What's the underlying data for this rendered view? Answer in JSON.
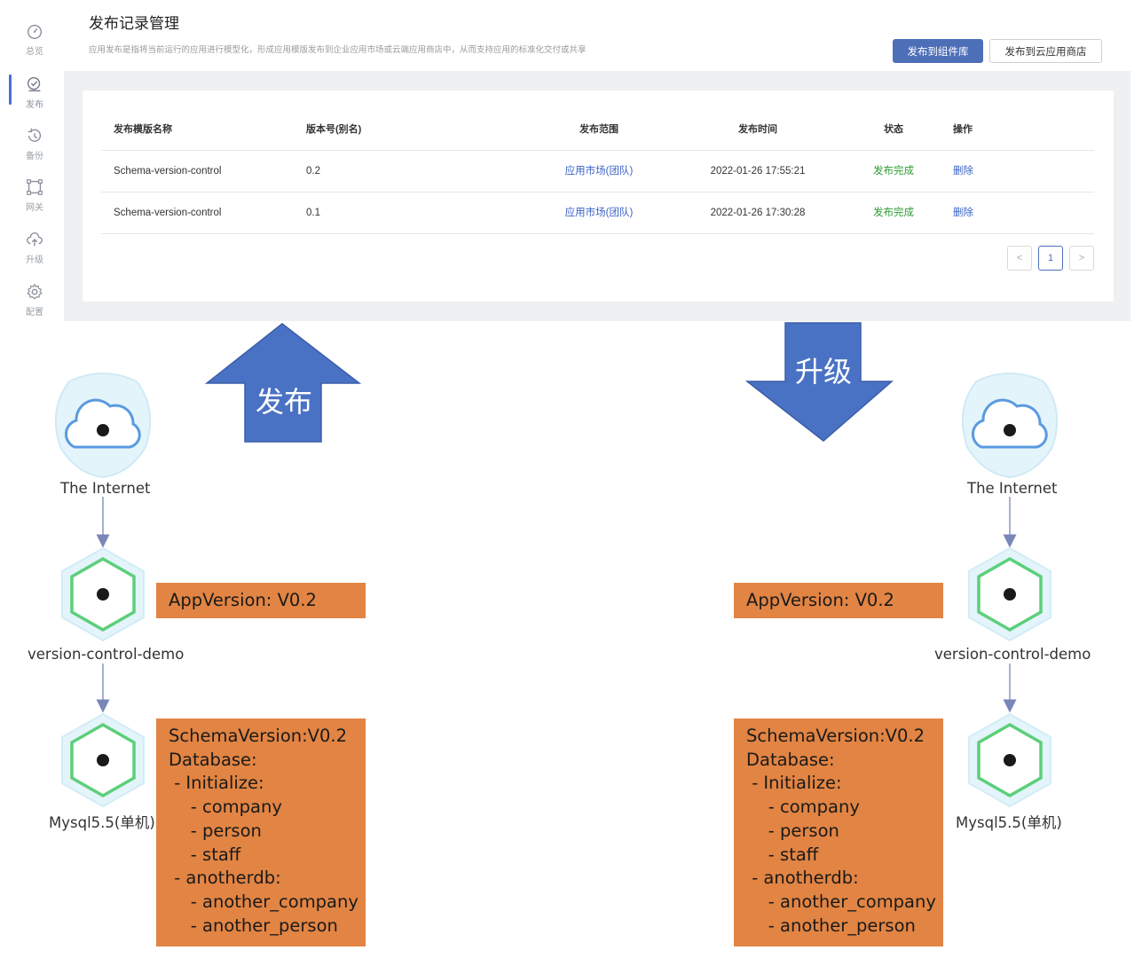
{
  "sidebar": {
    "items": [
      {
        "label": "总览",
        "icon": "dashboard-icon"
      },
      {
        "label": "发布",
        "icon": "publish-icon",
        "active": true
      },
      {
        "label": "备份",
        "icon": "backup-icon"
      },
      {
        "label": "网关",
        "icon": "gateway-icon"
      },
      {
        "label": "升级",
        "icon": "upgrade-cloud-icon"
      },
      {
        "label": "配置",
        "icon": "gear-icon"
      }
    ]
  },
  "header": {
    "title": "发布记录管理",
    "description": "应用发布是指将当前运行的应用进行模型化，形成应用模版发布到企业应用市场或云端应用商店中，从而支持应用的标准化交付或共享",
    "btn_publish_component": "发布到组件库",
    "btn_publish_cloud": "发布到云应用商店"
  },
  "table": {
    "columns": [
      "发布模版名称",
      "版本号(别名)",
      "发布范围",
      "发布时间",
      "状态",
      "操作"
    ],
    "rows": [
      {
        "name": "Schema-version-control",
        "version": "0.2",
        "scope": "应用市场(团队)",
        "time": "2022-01-26 17:55:21",
        "status": "发布完成",
        "action": "删除"
      },
      {
        "name": "Schema-version-control",
        "version": "0.1",
        "scope": "应用市场(团队)",
        "time": "2022-01-26 17:30:28",
        "status": "发布完成",
        "action": "删除"
      }
    ]
  },
  "pagination": {
    "prev": "<",
    "page": "1",
    "next": ">"
  },
  "diagram": {
    "publish_arrow": "发布",
    "upgrade_arrow": "升级",
    "left": {
      "internet": "The Internet",
      "app": "version-control-demo",
      "db": "Mysql5.5(单机)",
      "app_version": "AppVersion: V0.2",
      "schema_text": "SchemaVersion:V0.2\nDatabase:\n - Initialize:\n    - company\n    - person\n    - staff\n - anotherdb:\n    - another_company\n    - another_person"
    },
    "right": {
      "internet": "The Internet",
      "app": "version-control-demo",
      "db": "Mysql5.5(单机)",
      "app_version": "AppVersion: V0.2",
      "schema_text": "SchemaVersion:V0.2\nDatabase:\n - Initialize:\n    - company\n    - person\n    - staff\n - anotherdb:\n    - another_company\n    - another_person"
    }
  },
  "colors": {
    "primary": "#4d6fb8",
    "arrow_blue": "#4a72c4",
    "orange": "#e28443",
    "success": "#2f9a32",
    "link": "#3a62c4"
  }
}
